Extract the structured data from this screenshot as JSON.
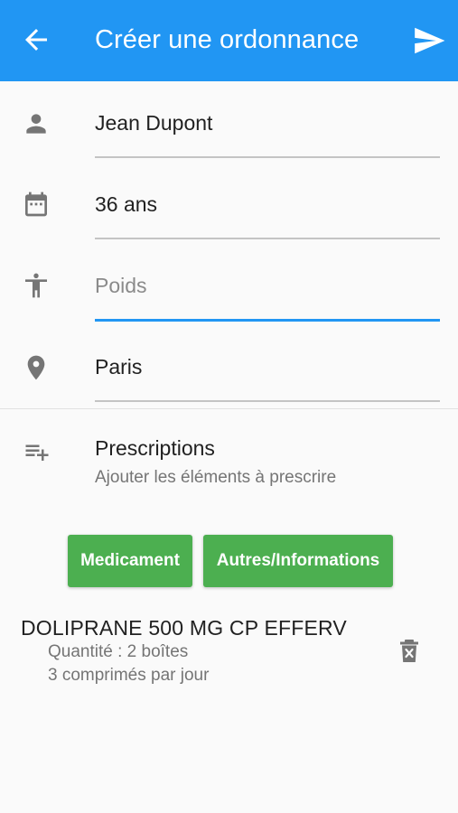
{
  "appbar": {
    "title": "Créer une ordonnance",
    "back_icon": "arrow-back-icon",
    "send_icon": "send-icon",
    "color": "#2196f3"
  },
  "fields": {
    "name": {
      "icon": "person-icon",
      "value": "Jean Dupont"
    },
    "age": {
      "icon": "calendar-icon",
      "value": "36 ans"
    },
    "weight": {
      "icon": "accessibility-icon",
      "value": "",
      "placeholder": "Poids"
    },
    "city": {
      "icon": "location-pin-icon",
      "value": "Paris"
    }
  },
  "prescriptions": {
    "icon": "playlist-add-icon",
    "title": "Prescriptions",
    "subtitle": "Ajouter les éléments à prescrire",
    "buttons": {
      "medicament": "Medicament",
      "other": "Autres/Informations"
    },
    "button_color": "#4caf50"
  },
  "items": [
    {
      "name": "DOLIPRANE 500 MG CP EFFERV",
      "quantity": "Quantité : 2 boîtes",
      "dosage": "3 comprimés par jour",
      "delete_icon": "delete-icon"
    }
  ]
}
